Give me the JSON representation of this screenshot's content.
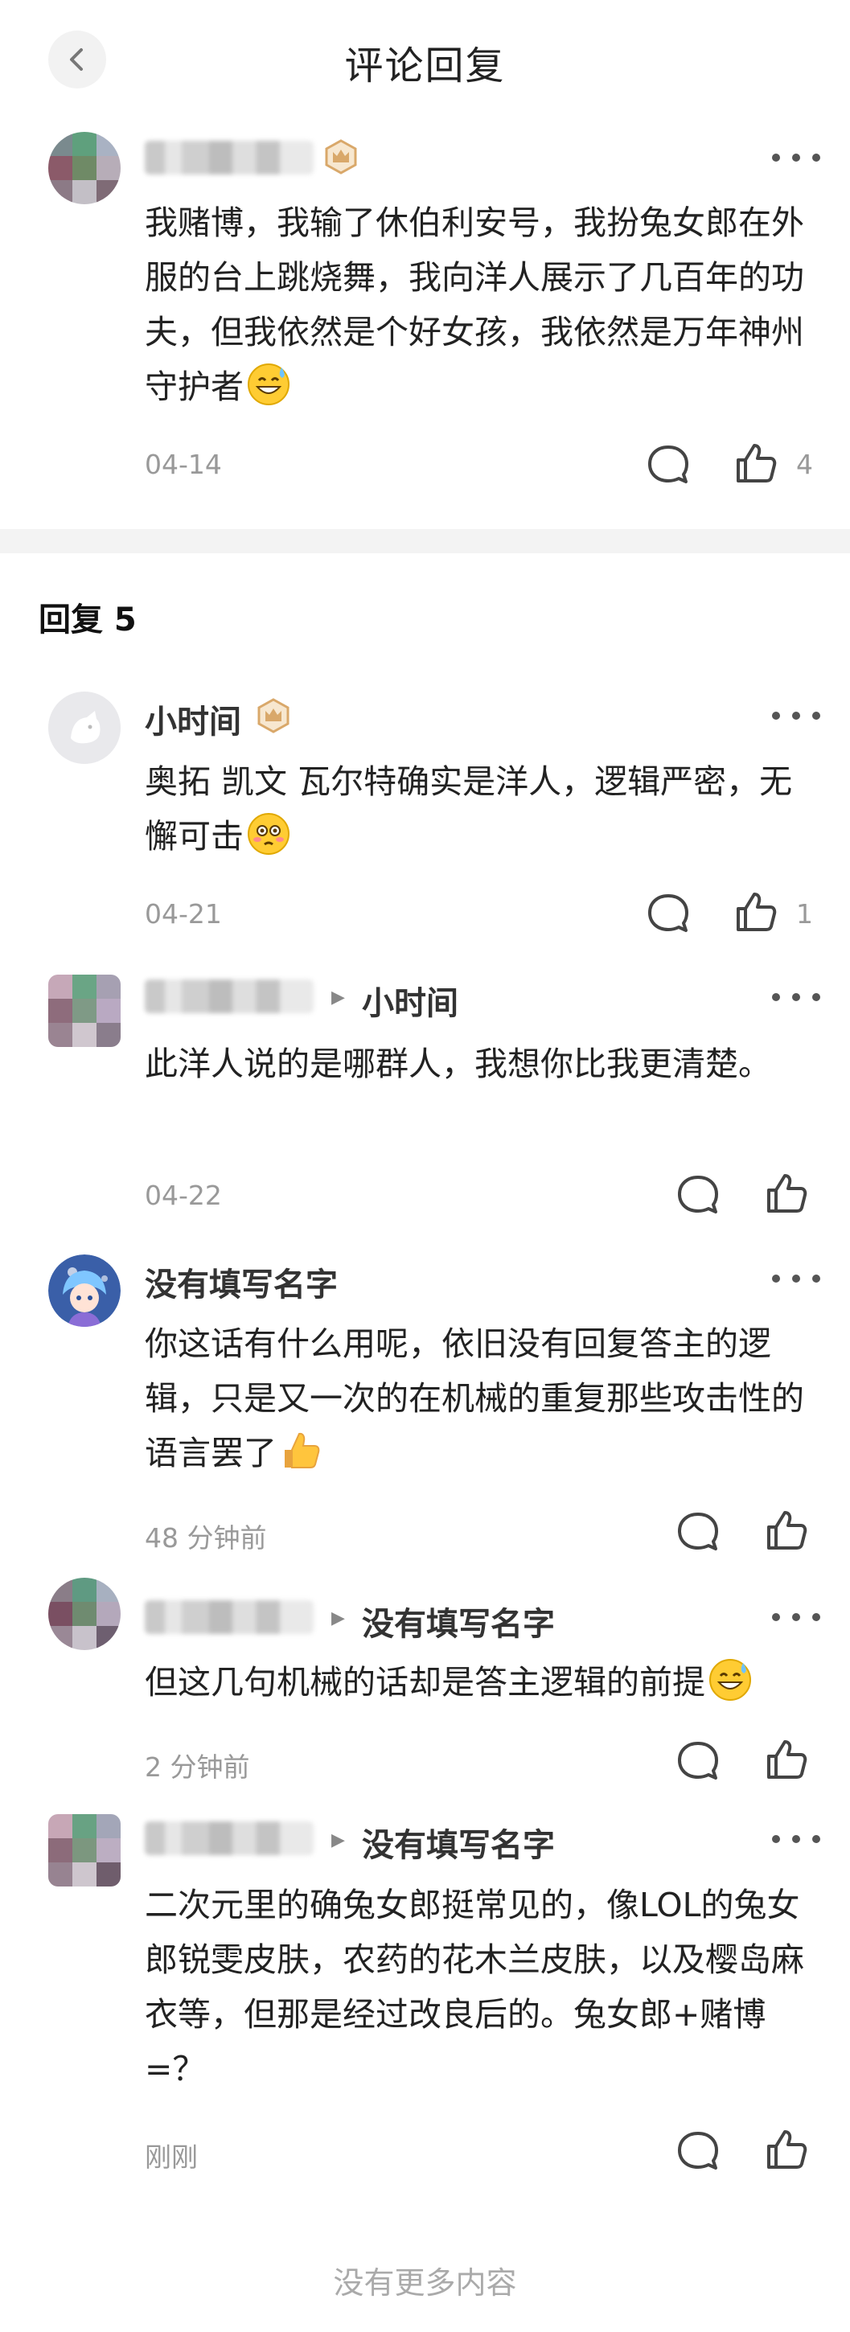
{
  "header": {
    "title": "评论回复"
  },
  "root_comment": {
    "text": "我赌博，我输了休伯利安号，我扮兔女郎在外服的台上跳烧舞，我向洋人展示了几百年的功夫，但我依然是个好女孩，我依然是万年神州守护者",
    "emoji": "grinning-sweat-emoji",
    "time": "04-14",
    "like_count": "4"
  },
  "replies_section": {
    "title": "回复 5"
  },
  "replies": [
    {
      "username": "小时间",
      "text": "奥拓 凯文 瓦尔特确实是洋人，逻辑严密，无懈可击",
      "emoji": "flushed-emoji",
      "time": "04-21",
      "like_count": "1"
    },
    {
      "reply_to": "小时间",
      "text": "此洋人说的是哪群人，我想你比我更清楚。",
      "time": "04-22"
    },
    {
      "username": "没有填写名字",
      "text": "你这话有什么用呢，依旧没有回复答主的逻辑，只是又一次的在机械的重复那些攻击性的语言罢了",
      "emoji": "thumbs-up-emoji",
      "time": "48 分钟前"
    },
    {
      "reply_to": "没有填写名字",
      "text": "但这几句机械的话却是答主逻辑的前提",
      "emoji": "grinning-sweat-emoji",
      "time": "2 分钟前"
    },
    {
      "reply_to": "没有填写名字",
      "text": "二次元里的确兔女郎挺常见的，像LOL的兔女郎锐雯皮肤，农药的花木兰皮肤，以及樱岛麻衣等，但那是经过改良后的。兔女郎+赌博=？",
      "time": "刚刚"
    }
  ],
  "footer": {
    "text": "没有更多内容"
  },
  "colors": {
    "text": "#222222",
    "muted": "#999999",
    "badge": "#d9a86a",
    "divider": "#f3f3f3"
  }
}
